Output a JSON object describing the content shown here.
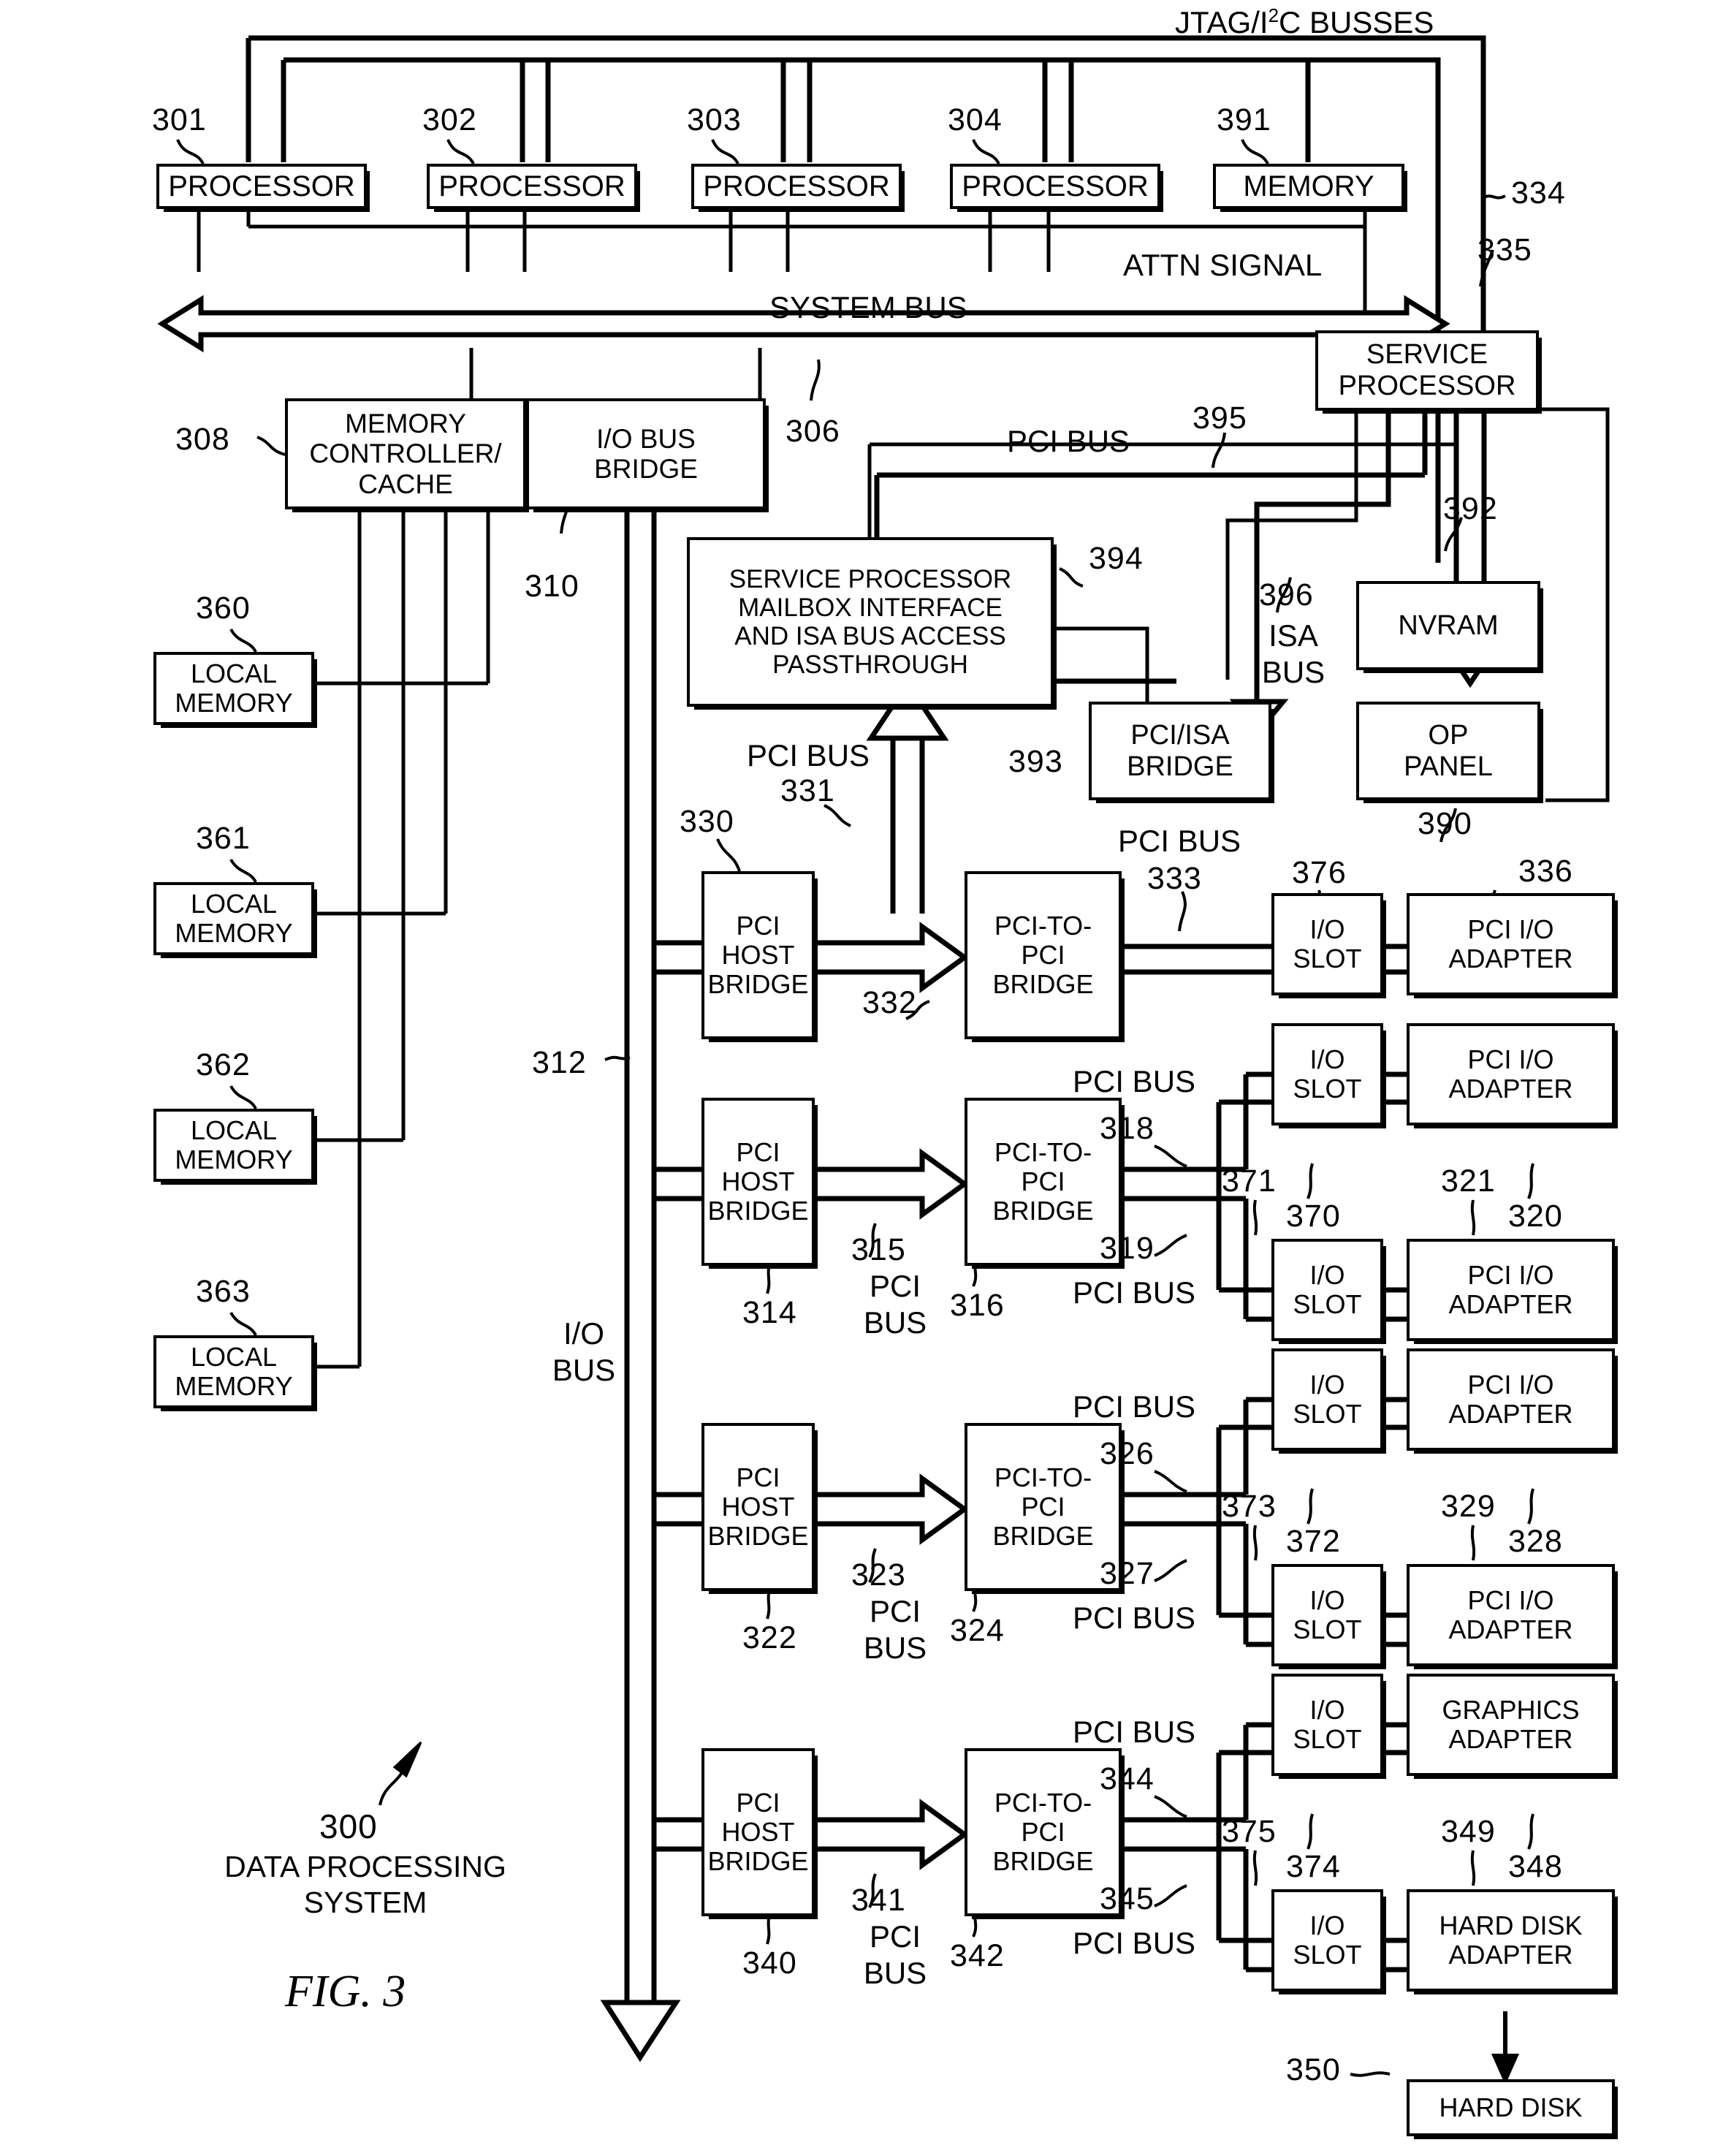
{
  "figure": {
    "caption": "FIG. 3",
    "system_ref": "300",
    "system_name_line1": "DATA PROCESSING",
    "system_name_line2": "SYSTEM"
  },
  "top_bus": {
    "jtag_label_pre": "JTAG/I",
    "jtag_label_sup": "2",
    "jtag_label_post": "C BUSSES"
  },
  "blocks": {
    "processor1": "PROCESSOR",
    "processor2": "PROCESSOR",
    "processor3": "PROCESSOR",
    "processor4": "PROCESSOR",
    "memory": "MEMORY",
    "service_processor_l1": "SERVICE",
    "service_processor_l2": "PROCESSOR",
    "memory_controller_l1": "MEMORY",
    "memory_controller_l2": "CONTROLLER/",
    "memory_controller_l3": "CACHE",
    "io_bus_bridge_l1": "I/O BUS",
    "io_bus_bridge_l2": "BRIDGE",
    "sp_mailbox_l1": "SERVICE PROCESSOR",
    "sp_mailbox_l2": "MAILBOX INTERFACE",
    "sp_mailbox_l3": "AND ISA BUS ACCESS",
    "sp_mailbox_l4": "PASSTHROUGH",
    "nvram": "NVRAM",
    "op_panel_l1": "OP",
    "op_panel_l2": "PANEL",
    "pci_isa_bridge_l1": "PCI/ISA",
    "pci_isa_bridge_l2": "BRIDGE",
    "local_memory": "LOCAL\nMEMORY",
    "local_memory_l1": "LOCAL",
    "local_memory_l2": "MEMORY",
    "pci_host_bridge_l1": "PCI",
    "pci_host_bridge_l2": "HOST",
    "pci_host_bridge_l3": "BRIDGE",
    "pci_to_pci_l1": "PCI-TO-",
    "pci_to_pci_l2": "PCI",
    "pci_to_pci_l3": "BRIDGE",
    "io_slot_l1": "I/O",
    "io_slot_l2": "SLOT",
    "pci_io_adapter_l1": "PCI I/O",
    "pci_io_adapter_l2": "ADAPTER",
    "graphics_adapter_l1": "GRAPHICS",
    "graphics_adapter_l2": "ADAPTER",
    "hard_disk_adapter_l1": "HARD DISK",
    "hard_disk_adapter_l2": "ADAPTER",
    "hard_disk": "HARD DISK"
  },
  "bus_labels": {
    "system_bus": "SYSTEM BUS",
    "attn_signal": "ATTN SIGNAL",
    "pci_bus": "PCI BUS",
    "io_bus_l1": "I/O",
    "io_bus_l2": "BUS",
    "isa_bus_l1": "ISA",
    "isa_bus_l2": "BUS",
    "pci_bus_l1": "PCI",
    "pci_bus_l2": "BUS"
  },
  "refs": {
    "r301": "301",
    "r302": "302",
    "r303": "303",
    "r304": "304",
    "r391": "391",
    "r334": "334",
    "r335": "335",
    "r306": "306",
    "r308": "308",
    "r310": "310",
    "r312": "312",
    "r395": "395",
    "r392": "392",
    "r394": "394",
    "r396": "396",
    "r393": "393",
    "r360": "360",
    "r361": "361",
    "r362": "362",
    "r363": "363",
    "r330": "330",
    "r331": "331",
    "r332": "332",
    "r333": "333",
    "r314": "314",
    "r315": "315",
    "r316": "316",
    "r318": "318",
    "r319": "319",
    "r320": "320",
    "r321": "321",
    "r370": "370",
    "r371": "371",
    "r322": "322",
    "r323": "323",
    "r324": "324",
    "r326": "326",
    "r327": "327",
    "r328": "328",
    "r329": "329",
    "r372": "372",
    "r373": "373",
    "r340": "340",
    "r341": "341",
    "r342": "342",
    "r344": "344",
    "r345": "345",
    "r348": "348",
    "r349": "349",
    "r374": "374",
    "r375": "375",
    "r376": "376",
    "r336": "336",
    "r390": "390",
    "r350": "350"
  },
  "colors": {
    "line": "#000000",
    "background": "#ffffff"
  }
}
